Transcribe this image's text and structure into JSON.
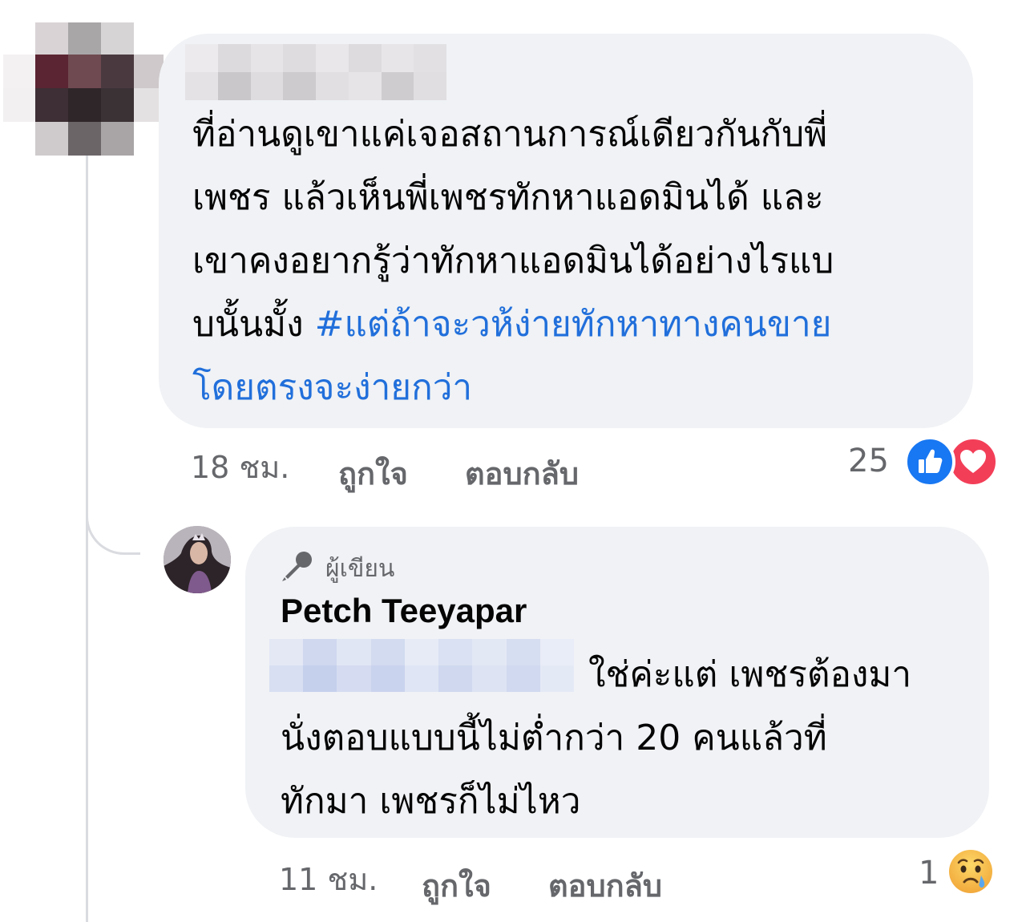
{
  "comment": {
    "lines": [
      "ที่อ่านดูเขาแค่เจอสถานการณ์เดียวกันกับพี่",
      "เพชร แล้วเห็นพี่เพชรทักหาแอดมินได้ และ",
      "เขาคงอยากรู้ว่าทักหาแอดมินได้อย่างไรแบ",
      "บนั้นมั้ง"
    ],
    "hashtag_part1": "#แต่ถ้าจะวห้ง่ายทักหาทางคนขาย",
    "hashtag_part2": "โดยตรงจะง่ายกว่า",
    "time": "18 ชม.",
    "like_label": "ถูกใจ",
    "reply_label": "ตอบกลับ",
    "reaction_count": "25",
    "reaction_icons": [
      "like-icon",
      "love-icon"
    ]
  },
  "reply": {
    "badge_label": "ผู้เขียน",
    "badge_icon": "microphone-icon",
    "author_name": "Petch Teeyapar",
    "line1": "ใช่ค่ะแต่ เพชรต้องมา",
    "line2": "นั่งตอบแบบนี้ไม่ต่ำกว่า 20 คนแล้วที่",
    "line3": "ทักมา เพชรก็ไม่ไหว",
    "time": "11 ชม.",
    "like_label": "ถูกใจ",
    "reply_label": "ตอบกลับ",
    "reaction_count": "1",
    "reaction_icons": [
      "sad-icon"
    ]
  },
  "colors": {
    "bubble": "#f0f2f5",
    "hashtag": "#216fdb",
    "meta_text": "#65676b",
    "like_blue": "#1877f2",
    "love_red": "#f33e58",
    "sad_yellow": "#f7b125"
  }
}
